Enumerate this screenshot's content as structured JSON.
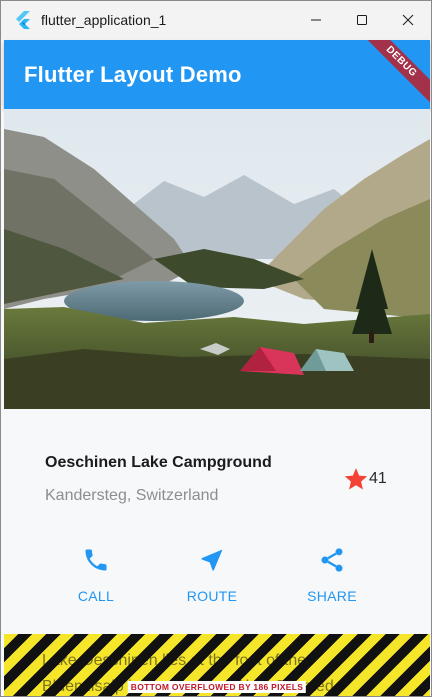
{
  "window": {
    "title": "flutter_application_1"
  },
  "appbar": {
    "title": "Flutter Layout Demo",
    "debug_banner": "DEBUG",
    "color": "#2196f3"
  },
  "hero": {
    "icon": "mountain-lake-campground-image"
  },
  "place": {
    "name": "Oeschinen Lake Campground",
    "location": "Kandersteg, Switzerland",
    "rating_count": "41",
    "star_color": "#f44336"
  },
  "actions": [
    {
      "label": "CALL",
      "icon": "phone-icon"
    },
    {
      "label": "ROUTE",
      "icon": "navigation-icon"
    },
    {
      "label": "SHARE",
      "icon": "share-icon"
    }
  ],
  "description": {
    "text": "Lake Oeschinen lies at the foot of the Blüemlisalp in the Bernese Alps. Situated"
  },
  "overflow": {
    "message": "BOTTOM OVERFLOWED BY 186 PIXELS"
  }
}
